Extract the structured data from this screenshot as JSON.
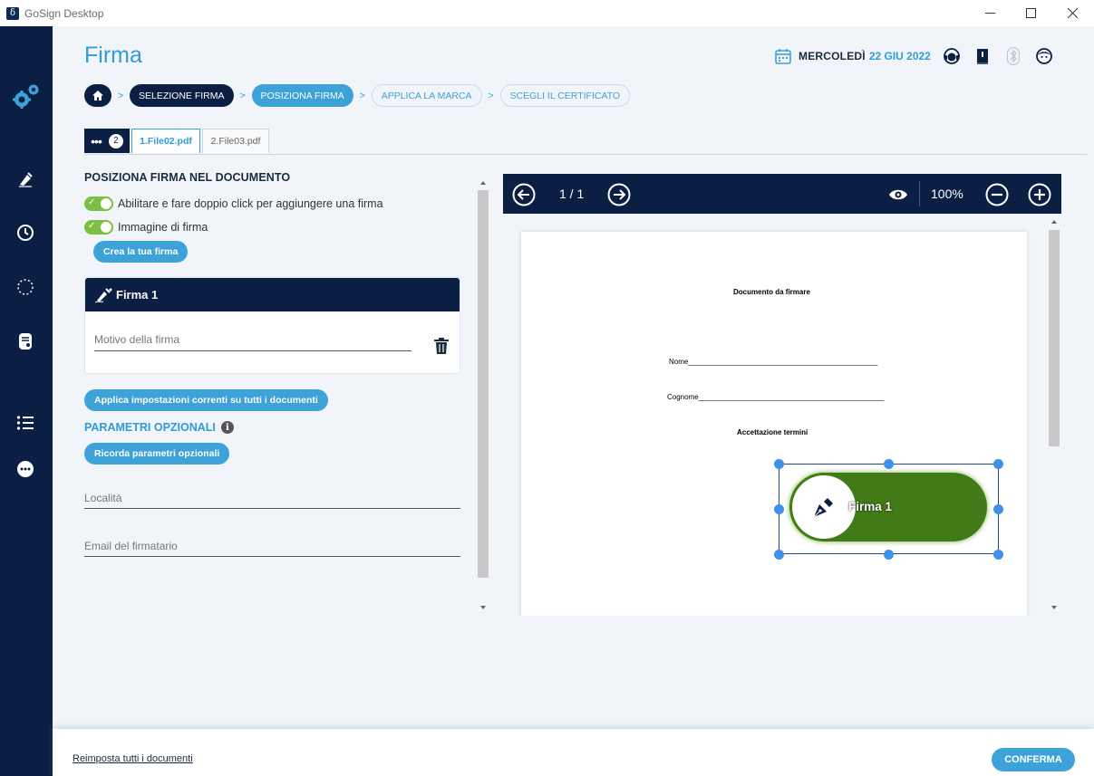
{
  "window": {
    "app_title": "GoSign Desktop",
    "logo_letter": "δ"
  },
  "header": {
    "page_title": "Firma",
    "date_day": "MERCOLEDÌ",
    "date_date": "22 GIU 2022"
  },
  "breadcrumb": {
    "steps": [
      {
        "label": "SELEZIONE FIRMA",
        "state": "done"
      },
      {
        "label": "POSIZIONA FIRMA",
        "state": "active"
      },
      {
        "label": "APPLICA LA MARCA",
        "state": "todo"
      },
      {
        "label": "SCEGLI IL CERTIFICATO",
        "state": "todo"
      }
    ]
  },
  "file_tabs": {
    "menu_dots": "•••",
    "count": "2",
    "tabs": [
      {
        "label": "1.File02.pdf",
        "active": true
      },
      {
        "label": "2.File03.pdf",
        "active": false
      }
    ]
  },
  "left_panel": {
    "section_title": "POSIZIONA FIRMA NEL DOCUMENTO",
    "toggle_double_click": {
      "label": "Abilitare e fare doppio click per aggiungere una firma",
      "on": true
    },
    "toggle_image": {
      "label": "Immagine di firma",
      "on": true
    },
    "create_signature_label": "Crea la tua firma",
    "signature_card": {
      "title": "Firma 1",
      "reason_placeholder": "Motivo della firma"
    },
    "apply_all_label": "Applica impostazioni correnti su tutti i documenti",
    "optional_params_title": "PARAMETRI OPZIONALI",
    "remember_params_label": "Ricorda parametri opzionali",
    "location_placeholder": "Località",
    "email_placeholder": "Email del firmatario"
  },
  "viewer": {
    "page_indicator": "1 / 1",
    "zoom": "100%",
    "document": {
      "title": "Documento da firmare",
      "name_line": "Nome_______________________________________________",
      "surname_line": "Cognome______________________________________________",
      "terms": "Accettazione termini"
    },
    "signature_field_label": "Firma 1"
  },
  "footer": {
    "reset_label": "Reimposta tutti i documenti",
    "confirm_label": "CONFERMA"
  },
  "colors": {
    "sidebar": "#0b1f44",
    "accent": "#3da2d8",
    "toggle_on": "#7bc043",
    "signature_stamp": "#417a17"
  }
}
